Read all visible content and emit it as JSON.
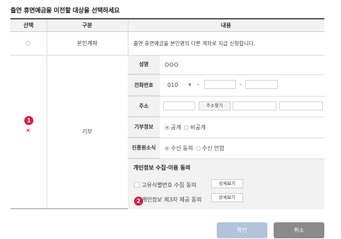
{
  "page_title": "출연 휴면예금을 이전할 대상을 선택하세요",
  "table": {
    "headers": {
      "select": "선택",
      "category": "구분",
      "content": "내용"
    }
  },
  "row_own": {
    "category": "본인계좌",
    "description": "출연 휴면예금을 본인명의 다른 계좌로 지급 신청합니다.",
    "selected": false
  },
  "row_donation": {
    "category": "기부",
    "selected": true,
    "name": {
      "label": "성명",
      "value": "OOO"
    },
    "phone": {
      "label": "전화번호",
      "prefix": "010",
      "dash": "-"
    },
    "address": {
      "label": "주소",
      "search_button": "주소찾기"
    },
    "donation_info": {
      "label": "기부정보",
      "option_public": "공개",
      "option_private": "비공개",
      "selected": "공개"
    },
    "promo_consent": {
      "label": "진흥원소식",
      "option_agree": "수신 동의",
      "option_decline": "수신 안함",
      "selected": "수신 동의"
    },
    "privacy": {
      "heading": "개인정보 수집·이용 동의",
      "items": [
        {
          "label": "고유식별번호 수집 동의",
          "button": "상세보기"
        },
        {
          "label": "개인정보 제3자 제공 동의",
          "button": "상세보기"
        }
      ]
    }
  },
  "badges": {
    "one": "1",
    "two": "2"
  },
  "actions": {
    "confirm": "확인",
    "cancel": "취소"
  },
  "colors": {
    "confirm_bg": "#b3c3dc",
    "cancel_bg": "#8a8a8a",
    "badge": "#d81b4a",
    "radio_selected": "#d6334f"
  }
}
